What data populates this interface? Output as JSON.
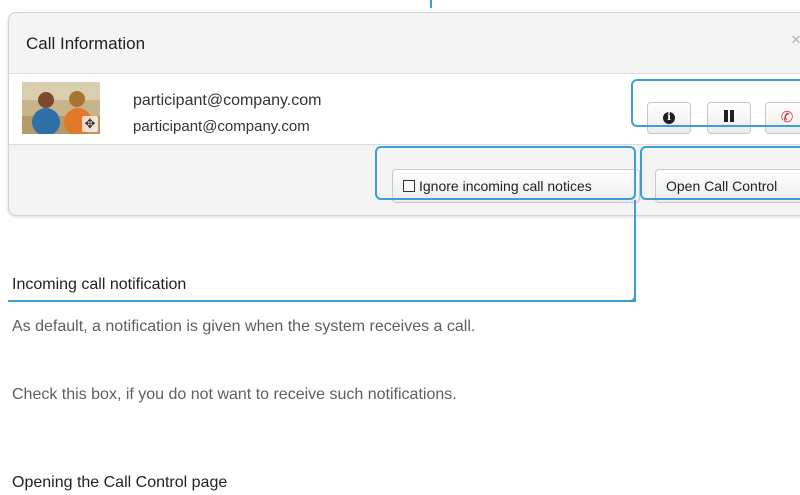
{
  "dialog": {
    "title": "Call Information",
    "close_symbol": "×"
  },
  "participant": {
    "name": "participant@company.com",
    "uri": "participant@company.com",
    "avatar_icon": "video-thumbnail",
    "move_symbol": "✥"
  },
  "controls": {
    "info_symbol": "i",
    "hangup_symbol": "✆"
  },
  "footer": {
    "ignore_label": "Ignore incoming call notices",
    "open_label": "Open Call Control"
  },
  "doc": {
    "heading_incoming": "Incoming call notification",
    "para_default": "As default, a notification is given when the system receives a call.",
    "para_check": "Check this box, if you do not want to receive such notifications.",
    "heading_opening": "Opening the Call Control page"
  },
  "colors": {
    "highlight": "#3b9fd6",
    "hangup": "#d0312d"
  }
}
